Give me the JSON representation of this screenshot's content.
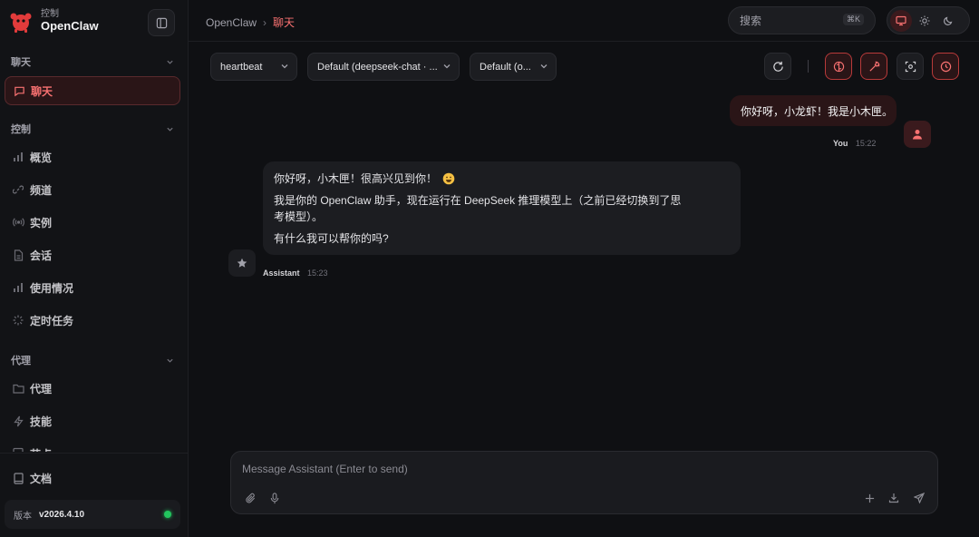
{
  "sidebar": {
    "brand_sub": "控制",
    "brand_name": "OpenClaw",
    "sections": {
      "chat": "聊天",
      "control": "控制",
      "agent": "代理"
    },
    "items": {
      "chat": "聊天",
      "overview": "概览",
      "channels": "频道",
      "instances": "实例",
      "sessions": "会话",
      "usage": "使用情况",
      "cron": "定时任务",
      "agents": "代理",
      "skills": "技能",
      "nodes": "节点",
      "docs": "文档"
    },
    "version_label": "版本",
    "version_value": "v2026.4.10",
    "status_color": "#22c55e"
  },
  "header": {
    "breadcrumb_root": "OpenClaw",
    "breadcrumb_sep": "›",
    "breadcrumb_current": "聊天",
    "search_placeholder": "搜索",
    "search_shortcut": "⌘K",
    "theme_selected": "monitor-icon"
  },
  "toolbar": {
    "session_select": "heartbeat",
    "model_select": "Default (deepseek-chat · ...",
    "thinking_select": "Default (o...",
    "buttons": [
      "refresh-icon",
      "brain-icon",
      "wrench-icon",
      "focus-icon",
      "clock-icon"
    ]
  },
  "messages": {
    "user": {
      "text": "你好呀，小龙虾！我是小木匣。",
      "name": "You",
      "time": "15:22"
    },
    "assistant": {
      "line1": "你好呀，小木匣！很高兴见到你！",
      "line2": "我是你的 OpenClaw 助手，现在运行在 DeepSeek 推理模型上（之前已经切换到了思考模型）。",
      "line3": "有什么我可以帮你的吗?",
      "name": "Assistant",
      "time": "15:23"
    }
  },
  "composer": {
    "placeholder": "Message Assistant (Enter to send)"
  },
  "colors": {
    "accent": "#f87171",
    "background": "#0f1013",
    "panel": "#1c1d21"
  }
}
